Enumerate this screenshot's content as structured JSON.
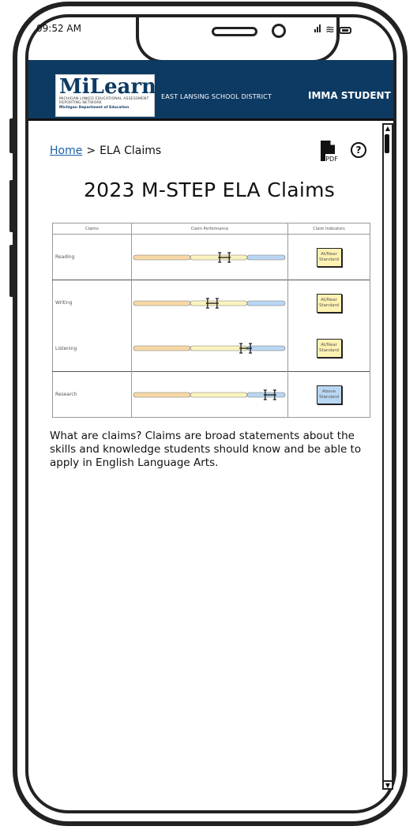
{
  "status_bar": {
    "time": "09:52 AM"
  },
  "header": {
    "logo_text": "MiLearn",
    "logo_subtitle": "MICHIGAN LINKED EDUCATIONAL ASSESSMENT REPORTING NETWORK",
    "logo_department": "Michigan Department of Education",
    "district": "EAST LANSING SCHOOL DISTRICT",
    "user_name": "IMMA STUDENT"
  },
  "breadcrumb": {
    "home": "Home",
    "separator": ">",
    "current": "ELA Claims"
  },
  "toolbar": {
    "pdf_label": "PDF",
    "help_label": "?"
  },
  "page_title": "2023 M-STEP ELA Claims",
  "claims_table": {
    "headers": [
      "Claims",
      "Claim Performance",
      "Claim Indicators"
    ],
    "rows": [
      {
        "name": "Reading",
        "performance": 0.6,
        "indicator_line1": "At/Near",
        "indicator_line2": "Standard",
        "indicator_color": "#fff2b3"
      },
      {
        "name": "Writing",
        "performance": 0.52,
        "indicator_line1": "At/Near",
        "indicator_line2": "Standard",
        "indicator_color": "#fff2b3"
      },
      {
        "name": "Listening",
        "performance": 0.74,
        "indicator_line1": "At/Near",
        "indicator_line2": "Standard",
        "indicator_color": "#fff2b3"
      },
      {
        "name": "Research",
        "performance": 0.9,
        "indicator_line1": "Above",
        "indicator_line2": "Standard",
        "indicator_color": "#b9d7f2"
      }
    ],
    "band_colors": {
      "below": "#f7d9a6",
      "near": "#fbf3bf",
      "above": "#b9d7f2"
    }
  },
  "description": "What are claims? Claims are broad statements about the skills and knowledge students should know and be able to apply in English Language Arts."
}
